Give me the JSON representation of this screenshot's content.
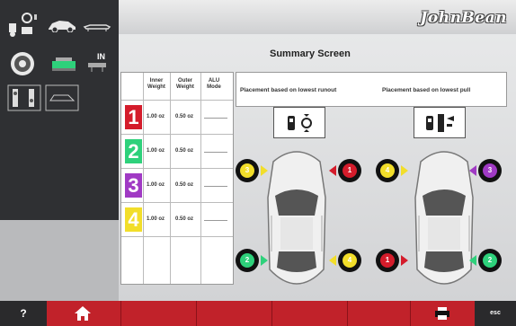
{
  "brand": "JohnBean",
  "title": "Summary Screen",
  "table": {
    "headers": [
      "Inner Weight",
      "Outer Weight",
      "ALU Mode"
    ],
    "rows": [
      {
        "num": "1",
        "color": "#d41c2b",
        "inner": "1.00 oz",
        "outer": "0.50 oz"
      },
      {
        "num": "2",
        "color": "#2ed17b",
        "inner": "1.00 oz",
        "outer": "0.50 oz"
      },
      {
        "num": "3",
        "color": "#a03ac4",
        "inner": "1.00 oz",
        "outer": "0.50 oz"
      },
      {
        "num": "4",
        "color": "#f2de2a",
        "inner": "1.00 oz",
        "outer": "0.50 oz"
      }
    ]
  },
  "placement": {
    "runout_label": "Placement based on lowest runout",
    "pull_label": "Placement based on lowest pull"
  },
  "wheels_runout": [
    {
      "id": "front-left",
      "num": "3",
      "color": "#f2de2a"
    },
    {
      "id": "front-right",
      "num": "1",
      "color": "#d41c2b"
    },
    {
      "id": "rear-left",
      "num": "2",
      "color": "#2ed17b"
    },
    {
      "id": "rear-right",
      "num": "4",
      "color": "#f2de2a"
    }
  ],
  "wheels_pull": [
    {
      "id": "front-left",
      "num": "4",
      "color": "#f2de2a"
    },
    {
      "id": "front-right",
      "num": "3",
      "color": "#a03ac4"
    },
    {
      "id": "rear-left",
      "num": "1",
      "color": "#d41c2b"
    },
    {
      "id": "rear-right",
      "num": "2",
      "color": "#2ed17b"
    }
  ],
  "bottombar": {
    "help": "?",
    "esc": "esc"
  },
  "icons": [
    "weights-icon",
    "car-side-icon",
    "car-lift-icon",
    "wheel-icon",
    "green-balancer-icon",
    "in-weight-icon",
    "alu-mode-icon",
    "car-outline-icon",
    "home-icon",
    "printer-icon"
  ]
}
